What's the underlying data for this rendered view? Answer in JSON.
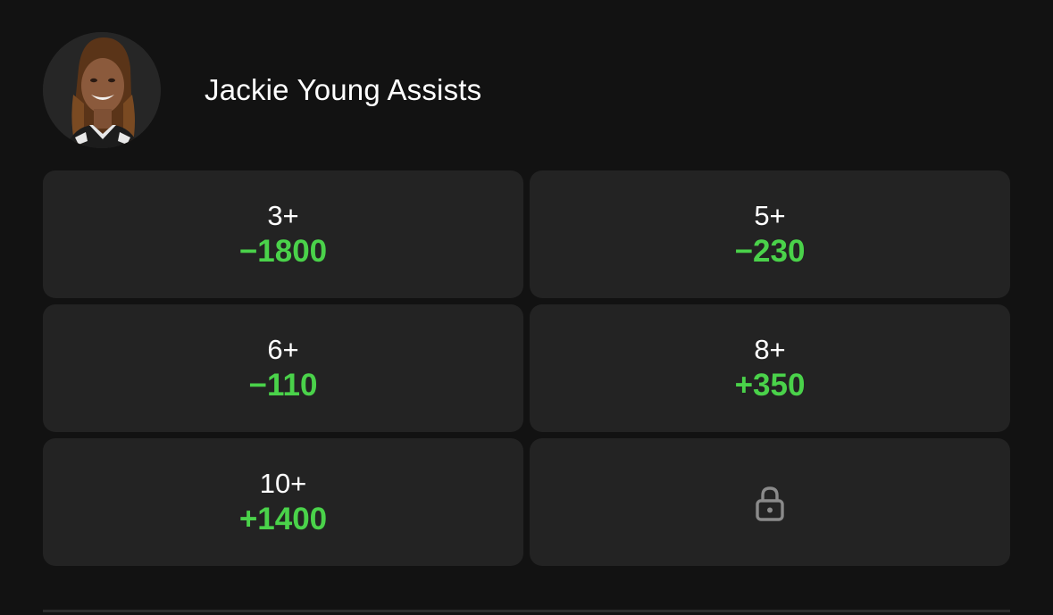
{
  "market": {
    "title": "Jackie Young Assists"
  },
  "avatar": {
    "icon": "player-headshot"
  },
  "options": [
    {
      "line": "3+",
      "odds": "−1800"
    },
    {
      "line": "5+",
      "odds": "−230"
    },
    {
      "line": "6+",
      "odds": "−110"
    },
    {
      "line": "8+",
      "odds": "+350"
    },
    {
      "line": "10+",
      "odds": "+1400"
    }
  ],
  "locked": {
    "icon": "lock-icon"
  },
  "colors": {
    "background": "#121212",
    "cell": "#232323",
    "odds_green": "#4ad24a",
    "text": "#ffffff",
    "lock_gray": "#8a8a8a"
  }
}
